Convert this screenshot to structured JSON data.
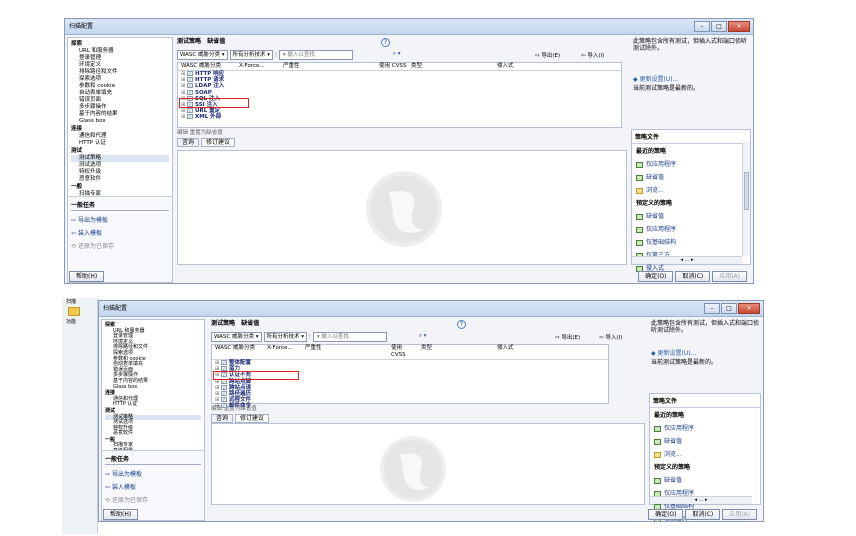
{
  "window_title": "扫描配置",
  "outer_app": {
    "title_left": "扫描",
    "left_labels": [
      "扫描",
      "功能"
    ]
  },
  "nav": [
    {
      "type": "sec",
      "label": "探索"
    },
    {
      "type": "it",
      "label": "URL 和服务器"
    },
    {
      "type": "it",
      "label": "登录管理"
    },
    {
      "type": "it",
      "label": "环境定义"
    },
    {
      "type": "it",
      "label": "排除路径和文件"
    },
    {
      "type": "it",
      "label": "探索选项"
    },
    {
      "type": "it",
      "label": "参数和 cookie"
    },
    {
      "type": "it",
      "label": "自动表单填充"
    },
    {
      "type": "it",
      "label": "错误页面"
    },
    {
      "type": "it",
      "label": "多步骤操作"
    },
    {
      "type": "it",
      "label": "基于内容的结果"
    },
    {
      "type": "it",
      "label": "Glass box"
    },
    {
      "type": "sec",
      "label": "连接"
    },
    {
      "type": "it",
      "label": "通信和代理"
    },
    {
      "type": "it",
      "label": "HTTP 认证"
    },
    {
      "type": "sec",
      "label": "测试"
    },
    {
      "type": "it",
      "label": "测试策略",
      "selected": true
    },
    {
      "type": "it",
      "label": "测试选项"
    },
    {
      "type": "it",
      "label": "特权升级"
    },
    {
      "type": "it",
      "label": "恶意软件"
    },
    {
      "type": "sec",
      "label": "一般"
    },
    {
      "type": "it",
      "label": "扫描专家"
    },
    {
      "type": "it",
      "label": "高级配置"
    }
  ],
  "tasks": {
    "header": "一般任务",
    "items": [
      {
        "label": "导出为模板",
        "icon": "export-icon",
        "enabled": true
      },
      {
        "label": "装入模板",
        "icon": "load-icon",
        "enabled": true
      },
      {
        "label": "还原为已保存",
        "icon": "restore-icon",
        "enabled": false
      }
    ]
  },
  "policy": {
    "title": "测试策略",
    "name": "缺省值"
  },
  "filters": {
    "category": "WASC 威胁分类",
    "scope": "所有分析技术",
    "search_placeholder": "输入以查找"
  },
  "toolbar": {
    "export": "导出(E)",
    "import": "导入(I)"
  },
  "grid_headers": [
    "WASC 威胁分类",
    "X-Force...",
    "严重性",
    "",
    "使用 CVSS",
    "类型",
    "",
    "侵入式"
  ],
  "rows_top": [
    "HTTP 响应",
    "HTTP 请求",
    "LDAP 注入",
    "SOAP",
    "SQL 注入",
    "SSI 注入",
    "URL 重定",
    "XML 外部"
  ],
  "rows_bottom": [
    "整体配置",
    "蛮力",
    "认证不充",
    "跨站点脚",
    "跨站点请",
    "路径遍历",
    "远程文件",
    "邮件命令"
  ],
  "edit_bar": "编辑  重置为缺省值",
  "tabs": [
    "咨询",
    "修订建议"
  ],
  "right": {
    "info": "此策略包含所有测试，但插入式和端口侦听测试除外。",
    "update": "更新设置(U)...",
    "latest": "当前测试策略是最新的。",
    "files_header": "策略文件",
    "recent_header": "最近的策略",
    "recent": [
      "仅应用程序",
      "缺省值",
      "浏览..."
    ],
    "predef_header": "预定义的策略",
    "predef": [
      "缺省值",
      "仅应用程序",
      "仅基础结构",
      "仅第三方",
      "侵入式"
    ]
  },
  "footer": {
    "help": "帮助(H)",
    "ok": "确定(O)",
    "cancel": "取消(C)",
    "apply": "应用(A)"
  }
}
